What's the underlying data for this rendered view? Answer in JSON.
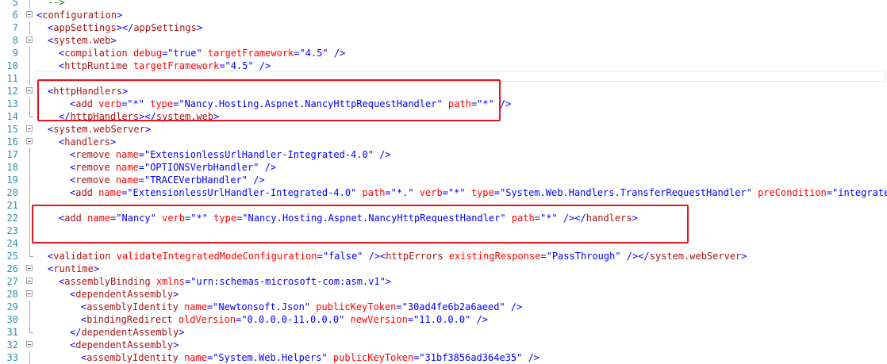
{
  "editor": {
    "lines": [
      {
        "n": "5",
        "indent": 1,
        "fold": false,
        "guide": "mid",
        "seg": [
          [
            "cm",
            "-->"
          ]
        ]
      },
      {
        "n": "6",
        "indent": 0,
        "fold": true,
        "guide": "none",
        "seg": [
          [
            "t",
            "<"
          ],
          [
            "e",
            "configuration"
          ],
          [
            "t",
            ">"
          ]
        ]
      },
      {
        "n": "7",
        "indent": 1,
        "fold": false,
        "guide": "mid",
        "seg": [
          [
            "t",
            "<"
          ],
          [
            "e",
            "appSettings"
          ],
          [
            "t",
            "></"
          ],
          [
            "e",
            "appSettings"
          ],
          [
            "t",
            ">"
          ]
        ]
      },
      {
        "n": "8",
        "indent": 1,
        "fold": true,
        "guide": "none",
        "seg": [
          [
            "t",
            "<"
          ],
          [
            "e",
            "system.web"
          ],
          [
            "t",
            ">"
          ]
        ]
      },
      {
        "n": "9",
        "indent": 2,
        "fold": false,
        "guide": "mid",
        "seg": [
          [
            "t",
            "<"
          ],
          [
            "e",
            "compilation"
          ],
          [
            "t",
            " "
          ],
          [
            "a",
            "debug"
          ],
          [
            "t",
            "=\""
          ],
          [
            "v",
            "true"
          ],
          [
            "t",
            "\" "
          ],
          [
            "a",
            "targetFramework"
          ],
          [
            "t",
            "=\""
          ],
          [
            "v",
            "4.5"
          ],
          [
            "t",
            "\" />"
          ]
        ]
      },
      {
        "n": "10",
        "indent": 2,
        "fold": false,
        "guide": "mid",
        "seg": [
          [
            "t",
            "<"
          ],
          [
            "e",
            "httpRuntime"
          ],
          [
            "t",
            " "
          ],
          [
            "a",
            "targetFramework"
          ],
          [
            "t",
            "=\""
          ],
          [
            "v",
            "4.5"
          ],
          [
            "t",
            "\" />"
          ]
        ]
      },
      {
        "n": "11",
        "indent": 0,
        "fold": false,
        "guide": "mid",
        "seg": []
      },
      {
        "n": "12",
        "indent": 1,
        "fold": true,
        "guide": "none",
        "seg": [
          [
            "t",
            "<"
          ],
          [
            "e",
            "httpHandlers"
          ],
          [
            "t",
            ">"
          ]
        ]
      },
      {
        "n": "13",
        "indent": 3,
        "fold": false,
        "guide": "mid",
        "seg": [
          [
            "t",
            "<"
          ],
          [
            "e",
            "add"
          ],
          [
            "t",
            " "
          ],
          [
            "a",
            "verb"
          ],
          [
            "t",
            "=\""
          ],
          [
            "v",
            "*"
          ],
          [
            "t",
            "\" "
          ],
          [
            "a",
            "type"
          ],
          [
            "t",
            "=\""
          ],
          [
            "v",
            "Nancy.Hosting.Aspnet.NancyHttpRequestHandler"
          ],
          [
            "t",
            "\" "
          ],
          [
            "a",
            "path"
          ],
          [
            "t",
            "=\""
          ],
          [
            "v",
            "*"
          ],
          [
            "t",
            "\" />"
          ]
        ]
      },
      {
        "n": "14",
        "indent": 2,
        "fold": false,
        "guide": "end",
        "seg": [
          [
            "t",
            "</"
          ],
          [
            "e",
            "httpHandlers"
          ],
          [
            "t",
            "></"
          ],
          [
            "e",
            "system.web"
          ],
          [
            "t",
            ">"
          ]
        ]
      },
      {
        "n": "15",
        "indent": 1,
        "fold": true,
        "guide": "none",
        "seg": [
          [
            "t",
            "<"
          ],
          [
            "e",
            "system.webServer"
          ],
          [
            "t",
            ">"
          ]
        ]
      },
      {
        "n": "16",
        "indent": 2,
        "fold": true,
        "guide": "none",
        "seg": [
          [
            "t",
            "<"
          ],
          [
            "e",
            "handlers"
          ],
          [
            "t",
            ">"
          ]
        ]
      },
      {
        "n": "17",
        "indent": 3,
        "fold": false,
        "guide": "mid",
        "seg": [
          [
            "t",
            "<"
          ],
          [
            "e",
            "remove"
          ],
          [
            "t",
            " "
          ],
          [
            "a",
            "name"
          ],
          [
            "t",
            "=\""
          ],
          [
            "v",
            "ExtensionlessUrlHandler-Integrated-4.0"
          ],
          [
            "t",
            "\" />"
          ]
        ]
      },
      {
        "n": "18",
        "indent": 3,
        "fold": false,
        "guide": "mid",
        "seg": [
          [
            "t",
            "<"
          ],
          [
            "e",
            "remove"
          ],
          [
            "t",
            " "
          ],
          [
            "a",
            "name"
          ],
          [
            "t",
            "=\""
          ],
          [
            "v",
            "OPTIONSVerbHandler"
          ],
          [
            "t",
            "\" />"
          ]
        ]
      },
      {
        "n": "19",
        "indent": 3,
        "fold": false,
        "guide": "mid",
        "seg": [
          [
            "t",
            "<"
          ],
          [
            "e",
            "remove"
          ],
          [
            "t",
            " "
          ],
          [
            "a",
            "name"
          ],
          [
            "t",
            "=\""
          ],
          [
            "v",
            "TRACEVerbHandler"
          ],
          [
            "t",
            "\" />"
          ]
        ]
      },
      {
        "n": "20",
        "indent": 3,
        "fold": false,
        "guide": "mid",
        "seg": [
          [
            "t",
            "<"
          ],
          [
            "e",
            "add"
          ],
          [
            "t",
            " "
          ],
          [
            "a",
            "name"
          ],
          [
            "t",
            "=\""
          ],
          [
            "v",
            "ExtensionlessUrlHandler-Integrated-4.0"
          ],
          [
            "t",
            "\" "
          ],
          [
            "a",
            "path"
          ],
          [
            "t",
            "=\""
          ],
          [
            "v",
            "*."
          ],
          [
            "t",
            "\" "
          ],
          [
            "a",
            "verb"
          ],
          [
            "t",
            "=\""
          ],
          [
            "v",
            "*"
          ],
          [
            "t",
            "\" "
          ],
          [
            "a",
            "type"
          ],
          [
            "t",
            "=\""
          ],
          [
            "v",
            "System.Web.Handlers.TransferRequestHandler"
          ],
          [
            "t",
            "\" "
          ],
          [
            "a",
            "preCondition"
          ],
          [
            "t",
            "=\""
          ],
          [
            "v",
            "integratedMode"
          ]
        ]
      },
      {
        "n": "21",
        "indent": 0,
        "fold": false,
        "guide": "mid",
        "seg": []
      },
      {
        "n": "22",
        "indent": 2,
        "fold": false,
        "guide": "mid",
        "seg": [
          [
            "t",
            "<"
          ],
          [
            "e",
            "add"
          ],
          [
            "t",
            " "
          ],
          [
            "a",
            "name"
          ],
          [
            "t",
            "=\""
          ],
          [
            "v",
            "Nancy"
          ],
          [
            "t",
            "\" "
          ],
          [
            "a",
            "verb"
          ],
          [
            "t",
            "=\""
          ],
          [
            "v",
            "*"
          ],
          [
            "t",
            "\" "
          ],
          [
            "a",
            "type"
          ],
          [
            "t",
            "=\""
          ],
          [
            "v",
            "Nancy.Hosting.Aspnet.NancyHttpRequestHandler"
          ],
          [
            "t",
            "\" "
          ],
          [
            "a",
            "path"
          ],
          [
            "t",
            "=\""
          ],
          [
            "v",
            "*"
          ],
          [
            "t",
            "\" /></"
          ],
          [
            "e",
            "handlers"
          ],
          [
            "t",
            ">"
          ]
        ]
      },
      {
        "n": "23",
        "indent": 0,
        "fold": false,
        "guide": "mid",
        "seg": []
      },
      {
        "n": "24",
        "indent": 0,
        "fold": false,
        "guide": "mid",
        "seg": []
      },
      {
        "n": "25",
        "indent": 1,
        "fold": false,
        "guide": "end",
        "seg": [
          [
            "t",
            "<"
          ],
          [
            "e",
            "validation"
          ],
          [
            "t",
            " "
          ],
          [
            "a",
            "validateIntegratedModeConfiguration"
          ],
          [
            "t",
            "=\""
          ],
          [
            "v",
            "false"
          ],
          [
            "t",
            "\" /><"
          ],
          [
            "e",
            "httpErrors"
          ],
          [
            "t",
            " "
          ],
          [
            "a",
            "existingResponse"
          ],
          [
            "t",
            "=\""
          ],
          [
            "v",
            "PassThrough"
          ],
          [
            "t",
            "\" /></"
          ],
          [
            "e",
            "system.webServer"
          ],
          [
            "t",
            ">"
          ]
        ]
      },
      {
        "n": "26",
        "indent": 1,
        "fold": true,
        "guide": "none",
        "seg": [
          [
            "t",
            "<"
          ],
          [
            "e",
            "runtime"
          ],
          [
            "t",
            ">"
          ]
        ]
      },
      {
        "n": "27",
        "indent": 2,
        "fold": true,
        "guide": "none",
        "seg": [
          [
            "t",
            "<"
          ],
          [
            "e",
            "assemblyBinding"
          ],
          [
            "t",
            " "
          ],
          [
            "a",
            "xmlns"
          ],
          [
            "t",
            "=\""
          ],
          [
            "v",
            "urn:schemas-microsoft-com:asm.v1"
          ],
          [
            "t",
            "\">"
          ]
        ]
      },
      {
        "n": "28",
        "indent": 3,
        "fold": true,
        "guide": "none",
        "seg": [
          [
            "t",
            "<"
          ],
          [
            "e",
            "dependentAssembly"
          ],
          [
            "t",
            ">"
          ]
        ]
      },
      {
        "n": "29",
        "indent": 4,
        "fold": false,
        "guide": "mid",
        "seg": [
          [
            "t",
            "<"
          ],
          [
            "e",
            "assemblyIdentity"
          ],
          [
            "t",
            " "
          ],
          [
            "a",
            "name"
          ],
          [
            "t",
            "=\""
          ],
          [
            "v",
            "Newtonsoft.Json"
          ],
          [
            "t",
            "\" "
          ],
          [
            "a",
            "publicKeyToken"
          ],
          [
            "t",
            "=\""
          ],
          [
            "v",
            "30ad4fe6b2a6aeed"
          ],
          [
            "t",
            "\" />"
          ]
        ]
      },
      {
        "n": "30",
        "indent": 4,
        "fold": false,
        "guide": "mid",
        "seg": [
          [
            "t",
            "<"
          ],
          [
            "e",
            "bindingRedirect"
          ],
          [
            "t",
            " "
          ],
          [
            "a",
            "oldVersion"
          ],
          [
            "t",
            "=\""
          ],
          [
            "v",
            "0.0.0.0-11.0.0.0"
          ],
          [
            "t",
            "\" "
          ],
          [
            "a",
            "newVersion"
          ],
          [
            "t",
            "=\""
          ],
          [
            "v",
            "11.0.0.0"
          ],
          [
            "t",
            "\" />"
          ]
        ]
      },
      {
        "n": "31",
        "indent": 3,
        "fold": false,
        "guide": "end",
        "seg": [
          [
            "t",
            "</"
          ],
          [
            "e",
            "dependentAssembly"
          ],
          [
            "t",
            ">"
          ]
        ]
      },
      {
        "n": "32",
        "indent": 3,
        "fold": true,
        "guide": "none",
        "seg": [
          [
            "t",
            "<"
          ],
          [
            "e",
            "dependentAssembly"
          ],
          [
            "t",
            ">"
          ]
        ]
      },
      {
        "n": "33",
        "indent": 4,
        "fold": false,
        "guide": "mid",
        "seg": [
          [
            "t",
            "<"
          ],
          [
            "e",
            "assemblyIdentity"
          ],
          [
            "t",
            " "
          ],
          [
            "a",
            "name"
          ],
          [
            "t",
            "=\""
          ],
          [
            "v",
            "System.Web.Helpers"
          ],
          [
            "t",
            "\" "
          ],
          [
            "a",
            "publicKeyToken"
          ],
          [
            "t",
            "=\""
          ],
          [
            "v",
            "31bf3856ad364e35"
          ],
          [
            "t",
            "\" />"
          ]
        ]
      }
    ]
  },
  "annotations": {
    "color": "#e8141c",
    "boxes": [
      "httpHandlers-block",
      "nancy-handler-line"
    ]
  }
}
